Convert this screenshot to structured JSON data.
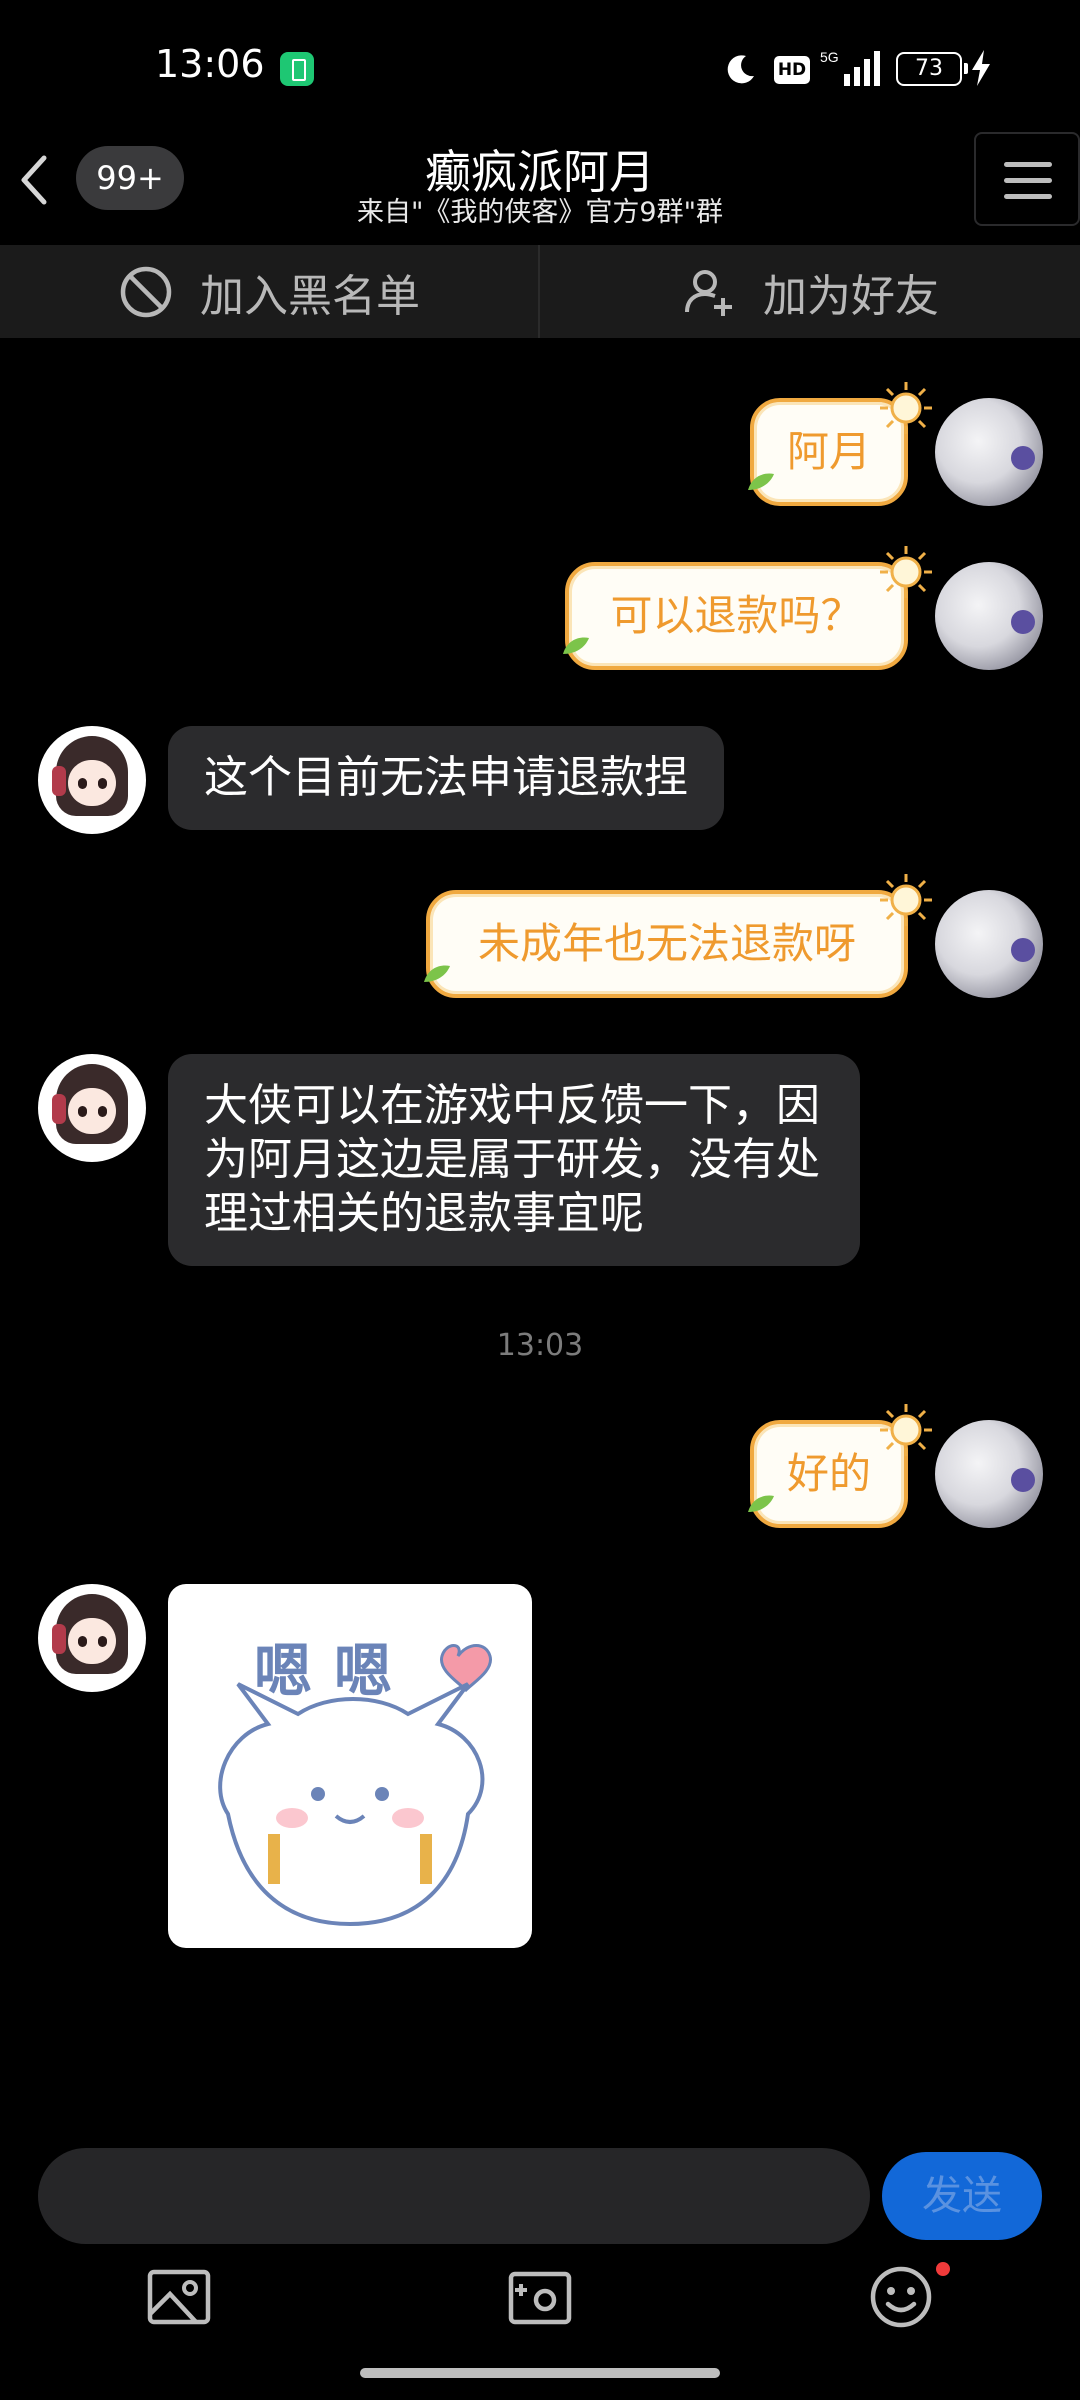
{
  "status_bar": {
    "time": "13:06",
    "hd_label": "HD",
    "network_label": "5G",
    "battery_level": "73"
  },
  "header": {
    "unread_count": "99+",
    "title": "癫疯派阿月",
    "subtitle": "来自\"《我的侠客》官方9群\"群"
  },
  "actions": {
    "block_label": "加入黑名单",
    "add_friend_label": "加为好友"
  },
  "messages": [
    {
      "sender": "self",
      "text": "阿月"
    },
    {
      "sender": "self",
      "text": "可以退款吗？"
    },
    {
      "sender": "other",
      "text": "这个目前无法申请退款捏"
    },
    {
      "sender": "self",
      "text": "未成年也无法退款呀"
    },
    {
      "sender": "other",
      "text": "大侠可以在游戏中反馈一下，因为阿月这边是属于研发，没有处理过相关的退款事宜呢"
    },
    {
      "sender": "self",
      "text": "好的"
    },
    {
      "sender": "other",
      "type": "sticker",
      "text": "嗯嗯"
    }
  ],
  "time_separator": "13:03",
  "input": {
    "placeholder": "",
    "send_label": "发送"
  },
  "colors": {
    "self_bubble_text": "#ef9a2e",
    "self_bubble_border": "#f0a940",
    "other_bubble_bg": "#2b2b2d",
    "send_button": "#1268d8"
  }
}
